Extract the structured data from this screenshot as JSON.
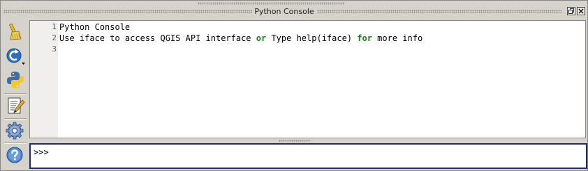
{
  "window": {
    "title": "Python Console",
    "buttons": [
      {
        "name": "float-button",
        "icon": "restore-window-icon"
      },
      {
        "name": "close-button",
        "icon": "close-icon"
      }
    ]
  },
  "toolbar": {
    "items": [
      {
        "name": "clear-console",
        "icon": "broom-icon"
      },
      {
        "name": "run-command",
        "icon": "refresh-run-icon"
      },
      {
        "name": "import-class",
        "icon": "python-logo-icon"
      },
      {
        "name": "show-editor",
        "icon": "notepad-edit-icon"
      },
      {
        "name": "settings",
        "icon": "gear-icon"
      },
      {
        "name": "help",
        "icon": "help-icon"
      }
    ]
  },
  "editor": {
    "lines": [
      {
        "number": "1",
        "text": "Python Console"
      },
      {
        "number": "2",
        "text": "Use iface to access QGIS API interface or Type help(iface) for more info"
      },
      {
        "number": "3",
        "text": ""
      }
    ],
    "line2_parts": {
      "a": "Use iface to access QGIS API interface ",
      "kw1": "or",
      "b": " Type help(iface) ",
      "kw2": "for",
      "c": " more info"
    },
    "keyword_color": "#1e7a1e"
  },
  "input": {
    "prompt": ">>>",
    "value": ""
  },
  "colors": {
    "background": "#d6d2cc",
    "input_border": "#252a6e"
  }
}
